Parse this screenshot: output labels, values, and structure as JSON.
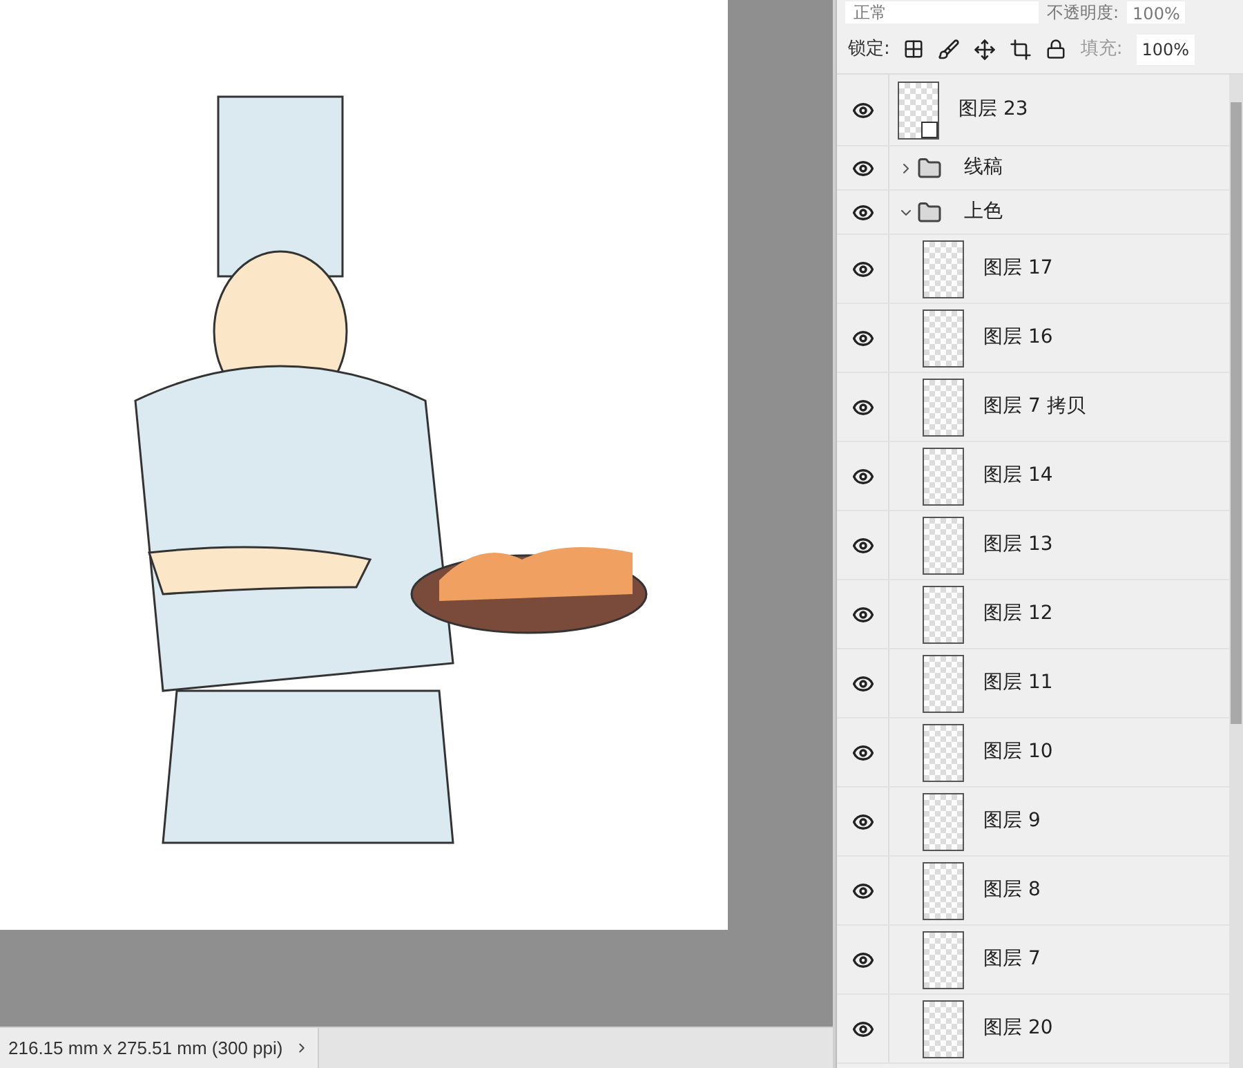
{
  "layers_panel": {
    "blend_mode": "正常",
    "opacity_label": "不透明度:",
    "opacity_value": "100%",
    "lock_label": "锁定:",
    "fill_label": "填充:",
    "fill_value": "100%",
    "layers": [
      {
        "kind": "layer",
        "name": "图层 23",
        "visible": true,
        "smart_object": true
      },
      {
        "kind": "group",
        "name": "线稿",
        "visible": true,
        "expanded": false
      },
      {
        "kind": "group",
        "name": "上色",
        "visible": true,
        "expanded": true,
        "children": [
          {
            "kind": "layer",
            "name": "图层 17",
            "visible": true
          },
          {
            "kind": "layer",
            "name": "图层 16",
            "visible": true
          },
          {
            "kind": "layer",
            "name": "图层 7 拷贝",
            "visible": true
          },
          {
            "kind": "layer",
            "name": "图层 14",
            "visible": true
          },
          {
            "kind": "layer",
            "name": "图层 13",
            "visible": true
          },
          {
            "kind": "layer",
            "name": "图层 12",
            "visible": true
          },
          {
            "kind": "layer",
            "name": "图层 11",
            "visible": true
          },
          {
            "kind": "layer",
            "name": "图层 10",
            "visible": true
          },
          {
            "kind": "layer",
            "name": "图层 9",
            "visible": true
          },
          {
            "kind": "layer",
            "name": "图层 8",
            "visible": true
          },
          {
            "kind": "layer",
            "name": "图层 7",
            "visible": true
          },
          {
            "kind": "layer",
            "name": "图层 20",
            "visible": true
          }
        ]
      }
    ]
  },
  "status_bar": {
    "document_size": "216.15 mm x 275.51 mm (300 ppi)"
  }
}
